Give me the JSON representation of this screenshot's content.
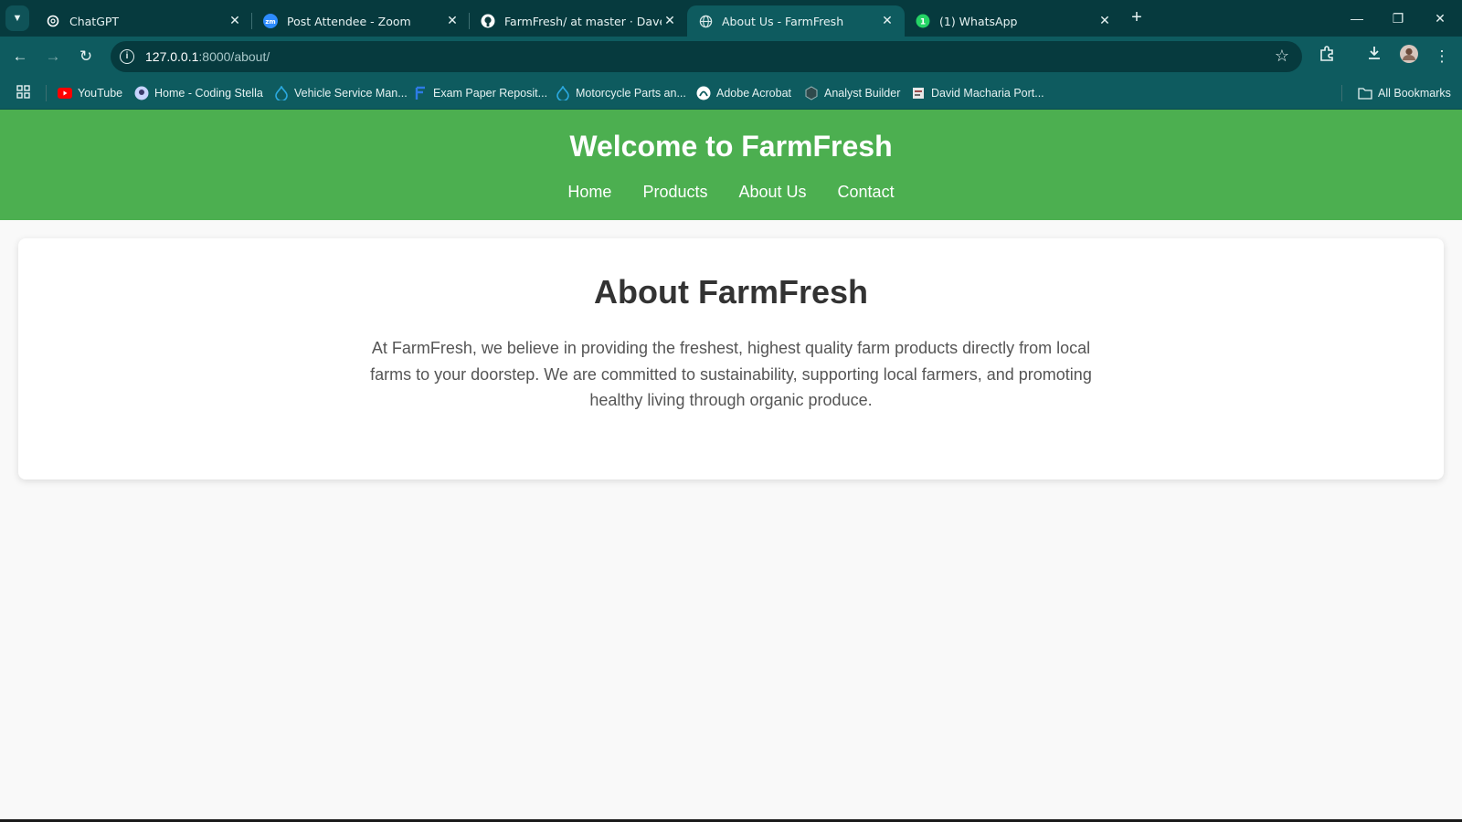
{
  "browser": {
    "tabs": [
      {
        "title": "ChatGPT",
        "icon": "chatgpt-icon",
        "active": false
      },
      {
        "title": "Post Attendee - Zoom",
        "icon": "zoom-icon",
        "active": false
      },
      {
        "title": "FarmFresh/ at master · Dave-nd",
        "icon": "github-icon",
        "active": false
      },
      {
        "title": "About Us - FarmFresh",
        "icon": "globe-icon",
        "active": true
      },
      {
        "title": "(1) WhatsApp",
        "icon": "whatsapp-icon",
        "active": false
      }
    ],
    "address": {
      "host": "127.0.0.1",
      "path": ":8000/about/"
    },
    "bookmarks": [
      {
        "label": "YouTube",
        "icon": "youtube-icon"
      },
      {
        "label": "Home - Coding Stella",
        "icon": "coding-stella-icon"
      },
      {
        "label": "Vehicle Service Man...",
        "icon": "drupal-icon"
      },
      {
        "label": "Exam Paper Reposit...",
        "icon": "f-logo-icon"
      },
      {
        "label": "Motorcycle Parts an...",
        "icon": "drupal-icon"
      },
      {
        "label": "Adobe Acrobat",
        "icon": "acrobat-icon"
      },
      {
        "label": "Analyst Builder",
        "icon": "analyst-icon"
      },
      {
        "label": "David Macharia Port...",
        "icon": "portfolio-icon"
      }
    ],
    "all_bookmarks": "All Bookmarks",
    "colors": {
      "frame": "#063a3e",
      "toolbar": "#0e5b5f"
    }
  },
  "site": {
    "title": "Welcome to FarmFresh",
    "nav": [
      "Home",
      "Products",
      "About Us",
      "Contact"
    ],
    "colors": {
      "header": "#4caf50",
      "background": "#f9f9f9"
    }
  },
  "about": {
    "heading": "About FarmFresh",
    "body": "At FarmFresh, we believe in providing the freshest, highest quality farm products directly from local farms to your doorstep. We are committed to sustainability, supporting local farmers, and promoting healthy living through organic produce."
  }
}
